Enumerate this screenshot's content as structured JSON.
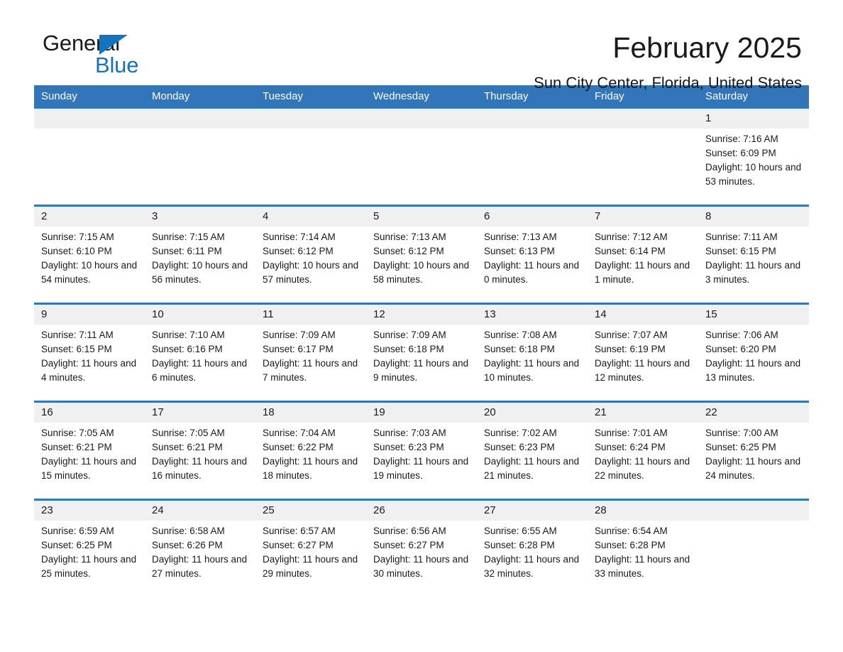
{
  "brand": {
    "name_part1": "General",
    "name_part2": "Blue",
    "triangle_color": "#1572bc"
  },
  "header": {
    "title": "February 2025",
    "location": "Sun City Center, Florida, United States",
    "accent_color": "#3275b8",
    "daynum_band_color": "#f0f0f0"
  },
  "weekday_headers": [
    "Sunday",
    "Monday",
    "Tuesday",
    "Wednesday",
    "Thursday",
    "Friday",
    "Saturday"
  ],
  "labels": {
    "sunrise_prefix": "Sunrise:",
    "sunset_prefix": "Sunset:",
    "daylight_prefix": "Daylight:"
  },
  "weeks": [
    [
      {
        "day": "",
        "blank": true
      },
      {
        "day": "",
        "blank": true
      },
      {
        "day": "",
        "blank": true
      },
      {
        "day": "",
        "blank": true
      },
      {
        "day": "",
        "blank": true
      },
      {
        "day": "",
        "blank": true
      },
      {
        "day": "1",
        "sunrise": "Sunrise: 7:16 AM",
        "sunset": "Sunset: 6:09 PM",
        "daylight": "Daylight: 10 hours and 53 minutes."
      }
    ],
    [
      {
        "day": "2",
        "sunrise": "Sunrise: 7:15 AM",
        "sunset": "Sunset: 6:10 PM",
        "daylight": "Daylight: 10 hours and 54 minutes."
      },
      {
        "day": "3",
        "sunrise": "Sunrise: 7:15 AM",
        "sunset": "Sunset: 6:11 PM",
        "daylight": "Daylight: 10 hours and 56 minutes."
      },
      {
        "day": "4",
        "sunrise": "Sunrise: 7:14 AM",
        "sunset": "Sunset: 6:12 PM",
        "daylight": "Daylight: 10 hours and 57 minutes."
      },
      {
        "day": "5",
        "sunrise": "Sunrise: 7:13 AM",
        "sunset": "Sunset: 6:12 PM",
        "daylight": "Daylight: 10 hours and 58 minutes."
      },
      {
        "day": "6",
        "sunrise": "Sunrise: 7:13 AM",
        "sunset": "Sunset: 6:13 PM",
        "daylight": "Daylight: 11 hours and 0 minutes."
      },
      {
        "day": "7",
        "sunrise": "Sunrise: 7:12 AM",
        "sunset": "Sunset: 6:14 PM",
        "daylight": "Daylight: 11 hours and 1 minute."
      },
      {
        "day": "8",
        "sunrise": "Sunrise: 7:11 AM",
        "sunset": "Sunset: 6:15 PM",
        "daylight": "Daylight: 11 hours and 3 minutes."
      }
    ],
    [
      {
        "day": "9",
        "sunrise": "Sunrise: 7:11 AM",
        "sunset": "Sunset: 6:15 PM",
        "daylight": "Daylight: 11 hours and 4 minutes."
      },
      {
        "day": "10",
        "sunrise": "Sunrise: 7:10 AM",
        "sunset": "Sunset: 6:16 PM",
        "daylight": "Daylight: 11 hours and 6 minutes."
      },
      {
        "day": "11",
        "sunrise": "Sunrise: 7:09 AM",
        "sunset": "Sunset: 6:17 PM",
        "daylight": "Daylight: 11 hours and 7 minutes."
      },
      {
        "day": "12",
        "sunrise": "Sunrise: 7:09 AM",
        "sunset": "Sunset: 6:18 PM",
        "daylight": "Daylight: 11 hours and 9 minutes."
      },
      {
        "day": "13",
        "sunrise": "Sunrise: 7:08 AM",
        "sunset": "Sunset: 6:18 PM",
        "daylight": "Daylight: 11 hours and 10 minutes."
      },
      {
        "day": "14",
        "sunrise": "Sunrise: 7:07 AM",
        "sunset": "Sunset: 6:19 PM",
        "daylight": "Daylight: 11 hours and 12 minutes."
      },
      {
        "day": "15",
        "sunrise": "Sunrise: 7:06 AM",
        "sunset": "Sunset: 6:20 PM",
        "daylight": "Daylight: 11 hours and 13 minutes."
      }
    ],
    [
      {
        "day": "16",
        "sunrise": "Sunrise: 7:05 AM",
        "sunset": "Sunset: 6:21 PM",
        "daylight": "Daylight: 11 hours and 15 minutes."
      },
      {
        "day": "17",
        "sunrise": "Sunrise: 7:05 AM",
        "sunset": "Sunset: 6:21 PM",
        "daylight": "Daylight: 11 hours and 16 minutes."
      },
      {
        "day": "18",
        "sunrise": "Sunrise: 7:04 AM",
        "sunset": "Sunset: 6:22 PM",
        "daylight": "Daylight: 11 hours and 18 minutes."
      },
      {
        "day": "19",
        "sunrise": "Sunrise: 7:03 AM",
        "sunset": "Sunset: 6:23 PM",
        "daylight": "Daylight: 11 hours and 19 minutes."
      },
      {
        "day": "20",
        "sunrise": "Sunrise: 7:02 AM",
        "sunset": "Sunset: 6:23 PM",
        "daylight": "Daylight: 11 hours and 21 minutes."
      },
      {
        "day": "21",
        "sunrise": "Sunrise: 7:01 AM",
        "sunset": "Sunset: 6:24 PM",
        "daylight": "Daylight: 11 hours and 22 minutes."
      },
      {
        "day": "22",
        "sunrise": "Sunrise: 7:00 AM",
        "sunset": "Sunset: 6:25 PM",
        "daylight": "Daylight: 11 hours and 24 minutes."
      }
    ],
    [
      {
        "day": "23",
        "sunrise": "Sunrise: 6:59 AM",
        "sunset": "Sunset: 6:25 PM",
        "daylight": "Daylight: 11 hours and 25 minutes."
      },
      {
        "day": "24",
        "sunrise": "Sunrise: 6:58 AM",
        "sunset": "Sunset: 6:26 PM",
        "daylight": "Daylight: 11 hours and 27 minutes."
      },
      {
        "day": "25",
        "sunrise": "Sunrise: 6:57 AM",
        "sunset": "Sunset: 6:27 PM",
        "daylight": "Daylight: 11 hours and 29 minutes."
      },
      {
        "day": "26",
        "sunrise": "Sunrise: 6:56 AM",
        "sunset": "Sunset: 6:27 PM",
        "daylight": "Daylight: 11 hours and 30 minutes."
      },
      {
        "day": "27",
        "sunrise": "Sunrise: 6:55 AM",
        "sunset": "Sunset: 6:28 PM",
        "daylight": "Daylight: 11 hours and 32 minutes."
      },
      {
        "day": "28",
        "sunrise": "Sunrise: 6:54 AM",
        "sunset": "Sunset: 6:28 PM",
        "daylight": "Daylight: 11 hours and 33 minutes."
      },
      {
        "day": "",
        "blank": true
      }
    ]
  ]
}
